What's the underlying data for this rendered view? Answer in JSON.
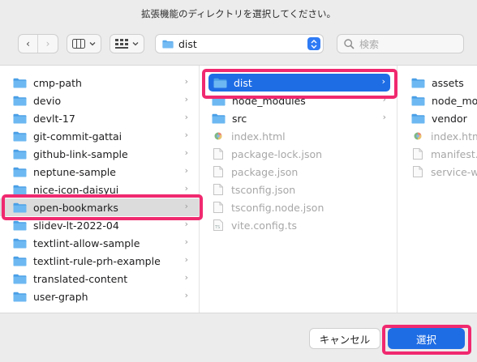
{
  "dialog": {
    "title": "拡張機能のディレクトリを選択してください。"
  },
  "toolbar": {
    "back_glyph": "‹",
    "forward_glyph": "›",
    "location": "dist",
    "search_placeholder": "検索"
  },
  "columns": [
    {
      "items": [
        {
          "label": "cmp-path",
          "kind": "folder",
          "chevron": true
        },
        {
          "label": "devio",
          "kind": "folder",
          "chevron": true
        },
        {
          "label": "devlt-17",
          "kind": "folder",
          "chevron": true
        },
        {
          "label": "git-commit-gattai",
          "kind": "folder",
          "chevron": true
        },
        {
          "label": "github-link-sample",
          "kind": "folder",
          "chevron": true
        },
        {
          "label": "neptune-sample",
          "kind": "folder",
          "chevron": true
        },
        {
          "label": "nice-icon-daisyui",
          "kind": "folder",
          "chevron": true
        },
        {
          "label": "open-bookmarks",
          "kind": "folder",
          "chevron": true,
          "selected": "gray"
        },
        {
          "label": "slidev-lt-2022-04",
          "kind": "folder",
          "chevron": true
        },
        {
          "label": "textlint-allow-sample",
          "kind": "folder",
          "chevron": true
        },
        {
          "label": "textlint-rule-prh-example",
          "kind": "folder",
          "chevron": true
        },
        {
          "label": "translated-content",
          "kind": "folder",
          "chevron": true
        },
        {
          "label": "user-graph",
          "kind": "folder",
          "chevron": true
        }
      ]
    },
    {
      "items": [
        {
          "label": "dist",
          "kind": "folder",
          "chevron": true,
          "selected": "blue"
        },
        {
          "label": "node_modules",
          "kind": "folder",
          "chevron": true
        },
        {
          "label": "src",
          "kind": "folder",
          "chevron": true
        },
        {
          "label": "index.html",
          "kind": "file-html",
          "dim": true
        },
        {
          "label": "package-lock.json",
          "kind": "file",
          "dim": true
        },
        {
          "label": "package.json",
          "kind": "file",
          "dim": true
        },
        {
          "label": "tsconfig.json",
          "kind": "file",
          "dim": true
        },
        {
          "label": "tsconfig.node.json",
          "kind": "file",
          "dim": true
        },
        {
          "label": "vite.config.ts",
          "kind": "file-ts",
          "dim": true
        }
      ]
    },
    {
      "items": [
        {
          "label": "assets",
          "kind": "folder"
        },
        {
          "label": "node_modules",
          "kind": "folder"
        },
        {
          "label": "vendor",
          "kind": "folder"
        },
        {
          "label": "index.html",
          "kind": "file-html",
          "dim": true
        },
        {
          "label": "manifest.json",
          "kind": "file",
          "dim": true
        },
        {
          "label": "service-worker.js",
          "kind": "file",
          "dim": true
        }
      ]
    }
  ],
  "buttons": {
    "cancel": "キャンセル",
    "choose": "選択"
  },
  "colors": {
    "accent": "#1f6de5",
    "folder": "#5aa9ec",
    "highlight": "#f0296f",
    "selected_gray": "#dcdcdc"
  }
}
